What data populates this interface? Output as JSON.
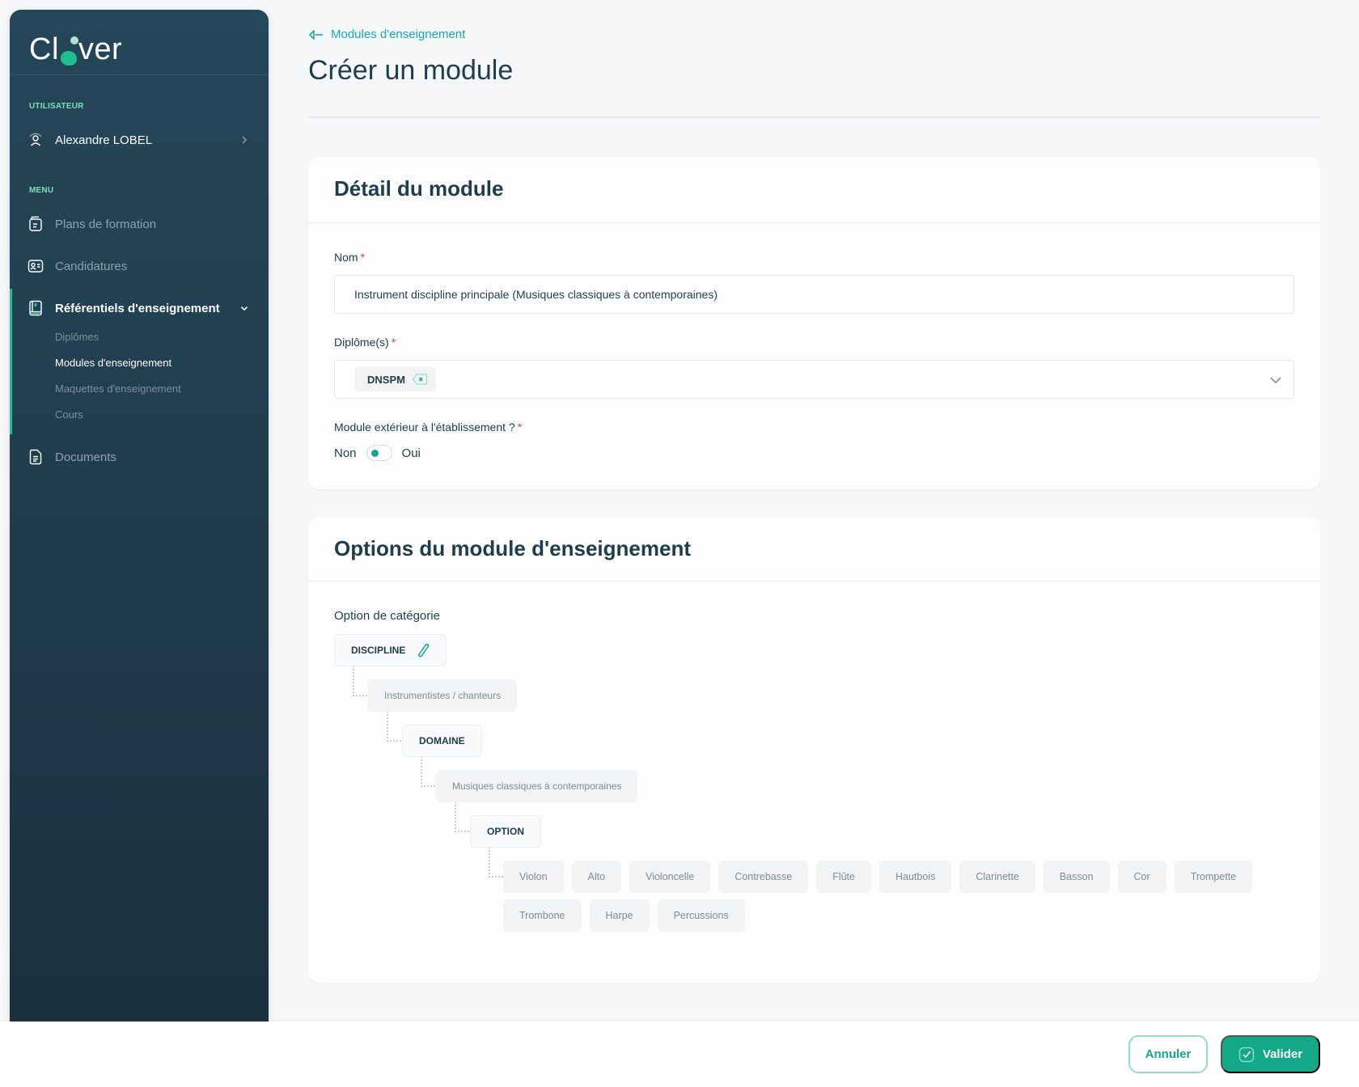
{
  "app": {
    "name_prefix": "Cl",
    "name_suffix": "ver"
  },
  "sidebar": {
    "user_section_label": "UTILISATEUR",
    "user_name": "Alexandre LOBEL",
    "menu_section_label": "MENU",
    "items": [
      {
        "label": "Plans de formation",
        "icon": "document-stack-icon"
      },
      {
        "label": "Candidatures",
        "icon": "id-card-icon"
      },
      {
        "label": "Référentiels d'enseignement",
        "icon": "book-icon",
        "active": true,
        "expanded": true
      },
      {
        "label": "Documents",
        "icon": "file-icon"
      }
    ],
    "sub_items": [
      {
        "label": "Diplômes"
      },
      {
        "label": "Modules d'enseignement",
        "current": true
      },
      {
        "label": "Maquettes d'enseignement"
      },
      {
        "label": "Cours"
      }
    ]
  },
  "header": {
    "breadcrumb": "Modules d'enseignement",
    "title": "Créer un module"
  },
  "detail_card": {
    "title": "Détail du module",
    "name_label": "Nom",
    "name_value": "Instrument discipline principale (Musiques classiques à contemporaines)",
    "diplomas_label": "Diplôme(s)",
    "diplomas_selected": [
      "DNSPM"
    ],
    "external_label": "Module extérieur à l'établissement ?",
    "toggle_off_label": "Non",
    "toggle_on_label": "Oui",
    "external_value": false,
    "required_mark": "*"
  },
  "options_card": {
    "title": "Options du module d'enseignement",
    "category_label": "Option de catégorie",
    "tree": [
      {
        "label": "DISCIPLINE",
        "type": "category",
        "editable": true
      },
      {
        "label": "Instrumentistes / chanteurs",
        "type": "value"
      },
      {
        "label": "DOMAINE",
        "type": "category"
      },
      {
        "label": "Musiques classiques à contemporaines",
        "type": "value"
      },
      {
        "label": "OPTION",
        "type": "category"
      }
    ],
    "options": [
      "Violon",
      "Alto",
      "Violoncelle",
      "Contrebasse",
      "Flûte",
      "Hautbois",
      "Clarinette",
      "Basson",
      "Cor",
      "Trompette",
      "Trombone",
      "Harpe",
      "Percussions"
    ]
  },
  "footer": {
    "cancel_label": "Annuler",
    "submit_label": "Valider"
  },
  "colors": {
    "accent": "#12a888",
    "sidebar_bg": "#25475a",
    "link": "#14a8b8",
    "required": "#e2424f"
  }
}
